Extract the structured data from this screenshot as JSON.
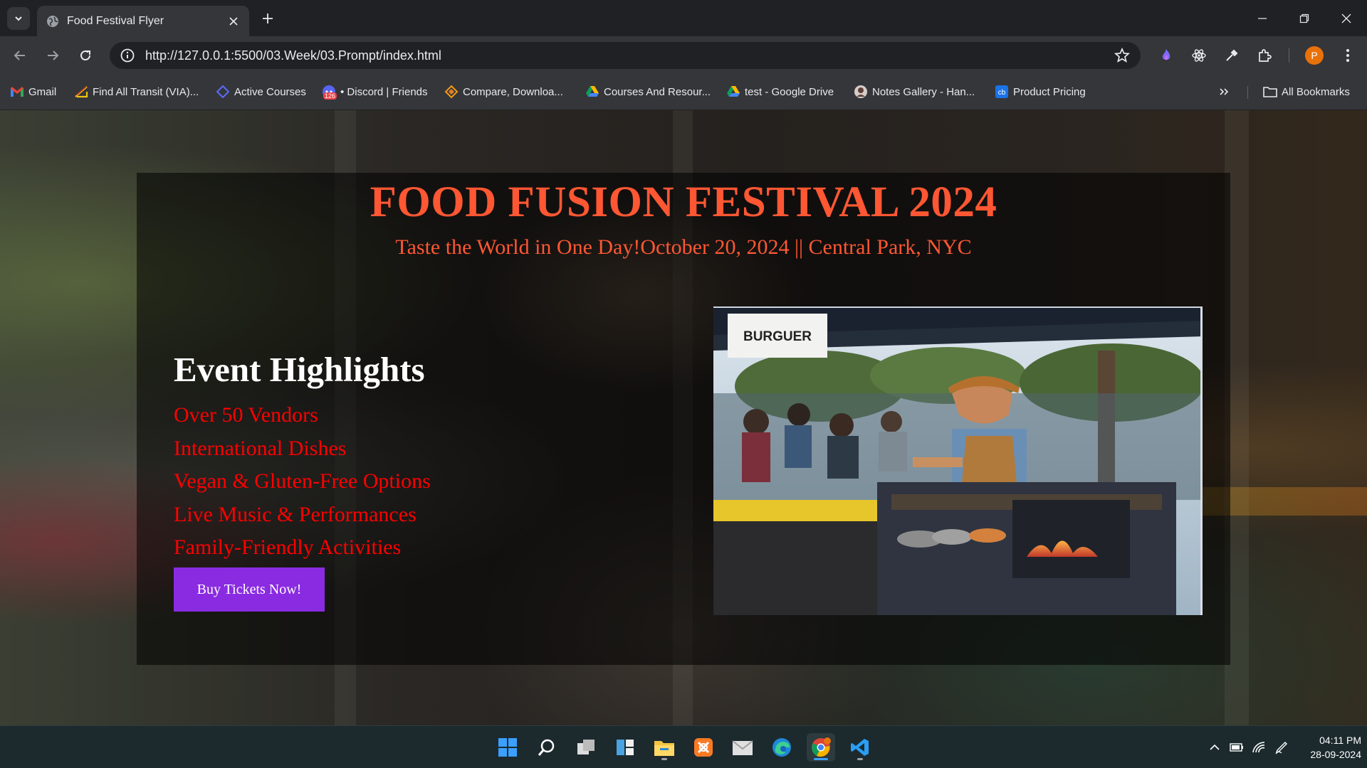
{
  "browser": {
    "tab": {
      "title": "Food Festival Flyer"
    },
    "address_bar": {
      "url": "http://127.0.0.1:5500/03.Week/03.Prompt/index.html"
    },
    "profile_initial": "P",
    "bookmarks": [
      {
        "label": "Gmail",
        "icon": "gmail-icon"
      },
      {
        "label": "Find All Transit (VIA)...",
        "icon": "transit-icon"
      },
      {
        "label": "Active Courses",
        "icon": "courses-icon"
      },
      {
        "label": "• Discord | Friends",
        "icon": "discord-icon",
        "badge": "126"
      },
      {
        "label": "Compare, Downloa...",
        "icon": "compare-icon"
      },
      {
        "label": "Courses And Resour...",
        "icon": "google-drive-icon"
      },
      {
        "label": "test - Google Drive",
        "icon": "google-drive-icon"
      },
      {
        "label": "Notes Gallery - Han...",
        "icon": "notes-icon"
      },
      {
        "label": "Product Pricing",
        "icon": "cb-icon"
      }
    ],
    "all_bookmarks_label": "All Bookmarks",
    "colors": {
      "tabstrip": "#202124",
      "toolbar": "#35363a",
      "profile": "#e8710a"
    }
  },
  "page": {
    "title": "FOOD FUSION FESTIVAL 2024",
    "subtitle": "Taste the World in One Day!October 20, 2024 || Central Park, NYC",
    "highlights_heading": "Event Highlights",
    "highlights": [
      "Over 50 Vendors",
      "International Dishes",
      "Vegan & Gluten-Free Options",
      "Live Music & Performances",
      "Family-Friendly Activities"
    ],
    "cta_label": "Buy Tickets Now!",
    "photo_sign": "BURGUER",
    "colors": {
      "title": "#ff5733",
      "highlight_items": "#ff0000",
      "cta": "#8a2be2"
    }
  },
  "taskbar": {
    "apps": [
      "start-icon",
      "search-icon",
      "task-view-icon",
      "widgets-icon",
      "file-explorer-icon",
      "xampp-icon",
      "mail-icon",
      "edge-icon",
      "chrome-icon",
      "vscode-icon"
    ],
    "time": "04:11 PM",
    "date": "28-09-2024"
  }
}
